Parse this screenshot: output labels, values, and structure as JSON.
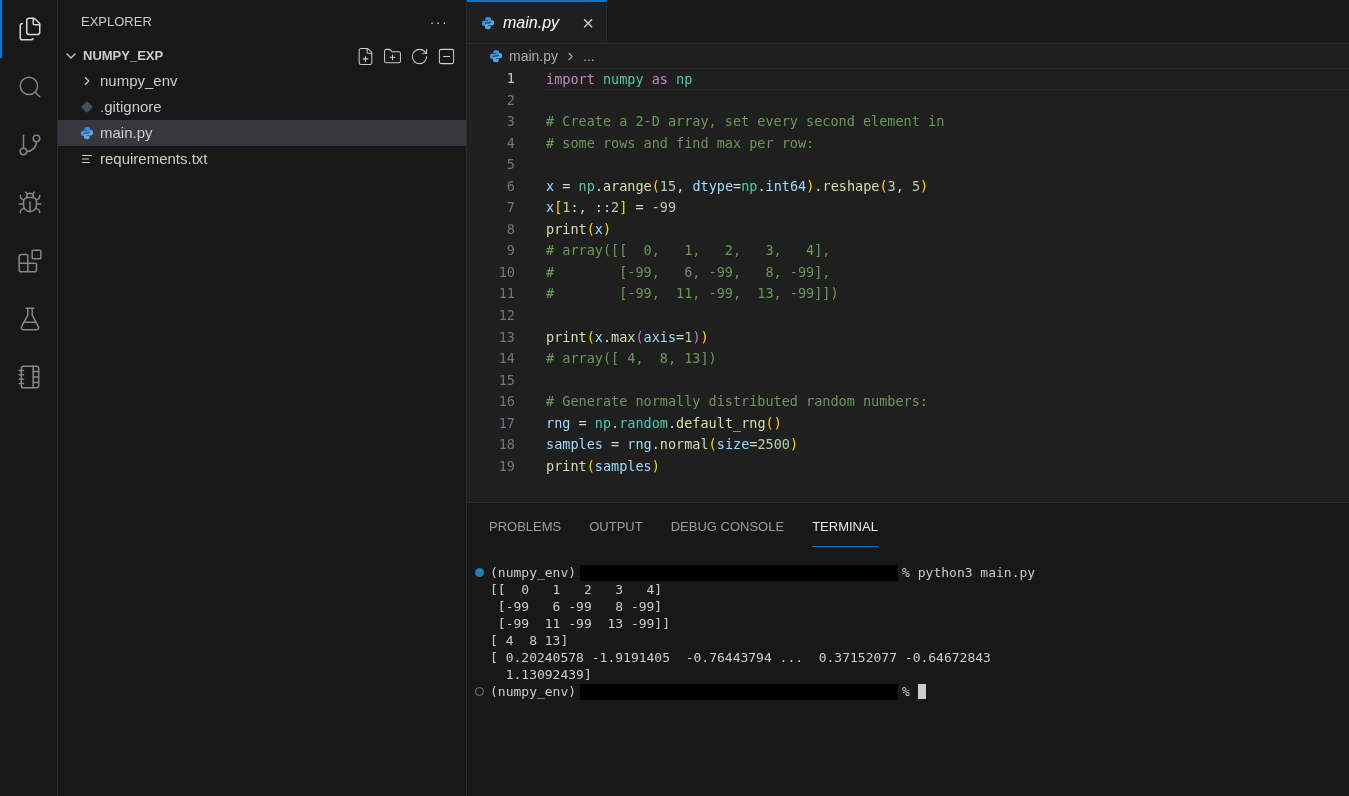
{
  "activity_bar": [
    {
      "kind": "files",
      "selected": true
    },
    {
      "kind": "search",
      "selected": false
    },
    {
      "kind": "source-control",
      "selected": false
    },
    {
      "kind": "run-debug",
      "selected": false
    },
    {
      "kind": "extensions",
      "selected": false
    },
    {
      "kind": "testing",
      "selected": false
    },
    {
      "kind": "notebook",
      "selected": false
    }
  ],
  "sidebar": {
    "title": "EXPLORER",
    "more": "···",
    "folder": {
      "name": "NUMPY_EXP",
      "expanded": true,
      "items": [
        {
          "kind": "folder",
          "name": "numpy_env",
          "expanded": false,
          "selected": false
        },
        {
          "kind": "git",
          "name": ".gitignore",
          "selected": false
        },
        {
          "kind": "python",
          "name": "main.py",
          "selected": true
        },
        {
          "kind": "text",
          "name": "requirements.txt",
          "selected": false
        }
      ]
    }
  },
  "editor": {
    "tabs": [
      {
        "label": "main.py",
        "selected": true,
        "close": "×"
      }
    ],
    "breadcrumb": [
      "main.py",
      "..."
    ],
    "lines": [
      {
        "n": "1",
        "current": true,
        "tokens": [
          {
            "t": "import ",
            "kind": "kw"
          },
          {
            "t": "numpy ",
            "kind": "mod"
          },
          {
            "t": "as ",
            "kind": "kw"
          },
          {
            "t": "np",
            "kind": "mod"
          }
        ]
      },
      {
        "n": "2",
        "current": false
      },
      {
        "n": "3",
        "current": false,
        "tokens": [
          {
            "t": "# Create a 2-D array, set every second element in",
            "kind": "comment"
          }
        ]
      },
      {
        "n": "4",
        "current": false,
        "tokens": [
          {
            "t": "# some rows and find max per row:",
            "kind": "comment"
          }
        ]
      },
      {
        "n": "5",
        "current": false
      },
      {
        "n": "6",
        "current": false,
        "tokens": [
          {
            "t": "x",
            "kind": "var"
          },
          {
            "t": " = ",
            "kind": "plain"
          },
          {
            "t": "np",
            "kind": "mod"
          },
          {
            "t": ".",
            "kind": "plain"
          },
          {
            "t": "arange",
            "kind": "fn"
          },
          {
            "t": "(",
            "kind": "b1"
          },
          {
            "t": "15",
            "kind": "num"
          },
          {
            "t": ", ",
            "kind": "plain"
          },
          {
            "t": "dtype",
            "kind": "var"
          },
          {
            "t": "=",
            "kind": "plain"
          },
          {
            "t": "np",
            "kind": "mod"
          },
          {
            "t": ".",
            "kind": "plain"
          },
          {
            "t": "int64",
            "kind": "var"
          },
          {
            "t": ")",
            "kind": "b1"
          },
          {
            "t": ".",
            "kind": "plain"
          },
          {
            "t": "reshape",
            "kind": "fn"
          },
          {
            "t": "(",
            "kind": "b1"
          },
          {
            "t": "3",
            "kind": "num"
          },
          {
            "t": ", ",
            "kind": "plain"
          },
          {
            "t": "5",
            "kind": "num"
          },
          {
            "t": ")",
            "kind": "b1"
          }
        ]
      },
      {
        "n": "7",
        "current": false,
        "tokens": [
          {
            "t": "x",
            "kind": "var"
          },
          {
            "t": "[",
            "kind": "b1"
          },
          {
            "t": "1",
            "kind": "num"
          },
          {
            "t": ":, ::",
            "kind": "plain"
          },
          {
            "t": "2",
            "kind": "num"
          },
          {
            "t": "]",
            "kind": "b1"
          },
          {
            "t": " = ",
            "kind": "plain"
          },
          {
            "t": "-99",
            "kind": "num"
          }
        ]
      },
      {
        "n": "8",
        "current": false,
        "tokens": [
          {
            "t": "print",
            "kind": "fn"
          },
          {
            "t": "(",
            "kind": "b1"
          },
          {
            "t": "x",
            "kind": "var"
          },
          {
            "t": ")",
            "kind": "b1"
          }
        ]
      },
      {
        "n": "9",
        "current": false,
        "tokens": [
          {
            "t": "# array([[  0,   1,   2,   3,   4],",
            "kind": "comment"
          }
        ]
      },
      {
        "n": "10",
        "current": false,
        "tokens": [
          {
            "t": "#        [-99,   6, -99,   8, -99],",
            "kind": "comment"
          }
        ]
      },
      {
        "n": "11",
        "current": false,
        "tokens": [
          {
            "t": "#        [-99,  11, -99,  13, -99]])",
            "kind": "comment"
          }
        ]
      },
      {
        "n": "12",
        "current": false
      },
      {
        "n": "13",
        "current": false,
        "tokens": [
          {
            "t": "print",
            "kind": "fn"
          },
          {
            "t": "(",
            "kind": "b1"
          },
          {
            "t": "x",
            "kind": "var"
          },
          {
            "t": ".",
            "kind": "plain"
          },
          {
            "t": "max",
            "kind": "fn"
          },
          {
            "t": "(",
            "kind": "b2"
          },
          {
            "t": "axis",
            "kind": "var"
          },
          {
            "t": "=",
            "kind": "plain"
          },
          {
            "t": "1",
            "kind": "num"
          },
          {
            "t": ")",
            "kind": "b2"
          },
          {
            "t": ")",
            "kind": "b1"
          }
        ]
      },
      {
        "n": "14",
        "current": false,
        "tokens": [
          {
            "t": "# array([ 4,  8, 13])",
            "kind": "comment"
          }
        ]
      },
      {
        "n": "15",
        "current": false
      },
      {
        "n": "16",
        "current": false,
        "tokens": [
          {
            "t": "# Generate normally distributed random numbers:",
            "kind": "comment"
          }
        ]
      },
      {
        "n": "17",
        "current": false,
        "tokens": [
          {
            "t": "rng",
            "kind": "var"
          },
          {
            "t": " = ",
            "kind": "plain"
          },
          {
            "t": "np",
            "kind": "mod"
          },
          {
            "t": ".",
            "kind": "plain"
          },
          {
            "t": "random",
            "kind": "mod"
          },
          {
            "t": ".",
            "kind": "plain"
          },
          {
            "t": "default_rng",
            "kind": "fn"
          },
          {
            "t": "(",
            "kind": "b1"
          },
          {
            "t": ")",
            "kind": "b1"
          }
        ]
      },
      {
        "n": "18",
        "current": false,
        "tokens": [
          {
            "t": "samples",
            "kind": "var"
          },
          {
            "t": " = ",
            "kind": "plain"
          },
          {
            "t": "rng",
            "kind": "var"
          },
          {
            "t": ".",
            "kind": "plain"
          },
          {
            "t": "normal",
            "kind": "fn"
          },
          {
            "t": "(",
            "kind": "b1"
          },
          {
            "t": "size",
            "kind": "var"
          },
          {
            "t": "=",
            "kind": "plain"
          },
          {
            "t": "2500",
            "kind": "num"
          },
          {
            "t": ")",
            "kind": "b1"
          }
        ]
      },
      {
        "n": "19",
        "current": false,
        "tokens": [
          {
            "t": "print",
            "kind": "fn"
          },
          {
            "t": "(",
            "kind": "b1"
          },
          {
            "t": "samples",
            "kind": "var"
          },
          {
            "t": ")",
            "kind": "b1"
          }
        ]
      }
    ]
  },
  "panel": {
    "tabs": [
      {
        "label": "PROBLEMS",
        "selected": false
      },
      {
        "label": "OUTPUT",
        "selected": false
      },
      {
        "label": "DEBUG CONSOLE",
        "selected": false
      },
      {
        "label": "TERMINAL",
        "selected": true
      }
    ],
    "terminal": [
      {
        "kind": "prompt",
        "finished": true,
        "env": "(numpy_env)",
        "command": "% python3 main.py"
      },
      {
        "kind": "output",
        "text": "[[  0   1   2   3   4]"
      },
      {
        "kind": "output",
        "text": " [-99   6 -99   8 -99]"
      },
      {
        "kind": "output",
        "text": " [-99  11 -99  13 -99]]"
      },
      {
        "kind": "output",
        "text": "[ 4  8 13]"
      },
      {
        "kind": "output",
        "text": "[ 0.20240578 -1.9191405  -0.76443794 ...  0.37152077 -0.64672843"
      },
      {
        "kind": "output",
        "text": "  1.13092439]"
      },
      {
        "kind": "prompt",
        "finished": false,
        "env": "(numpy_env)",
        "command": "%",
        "cursor": true
      }
    ]
  }
}
